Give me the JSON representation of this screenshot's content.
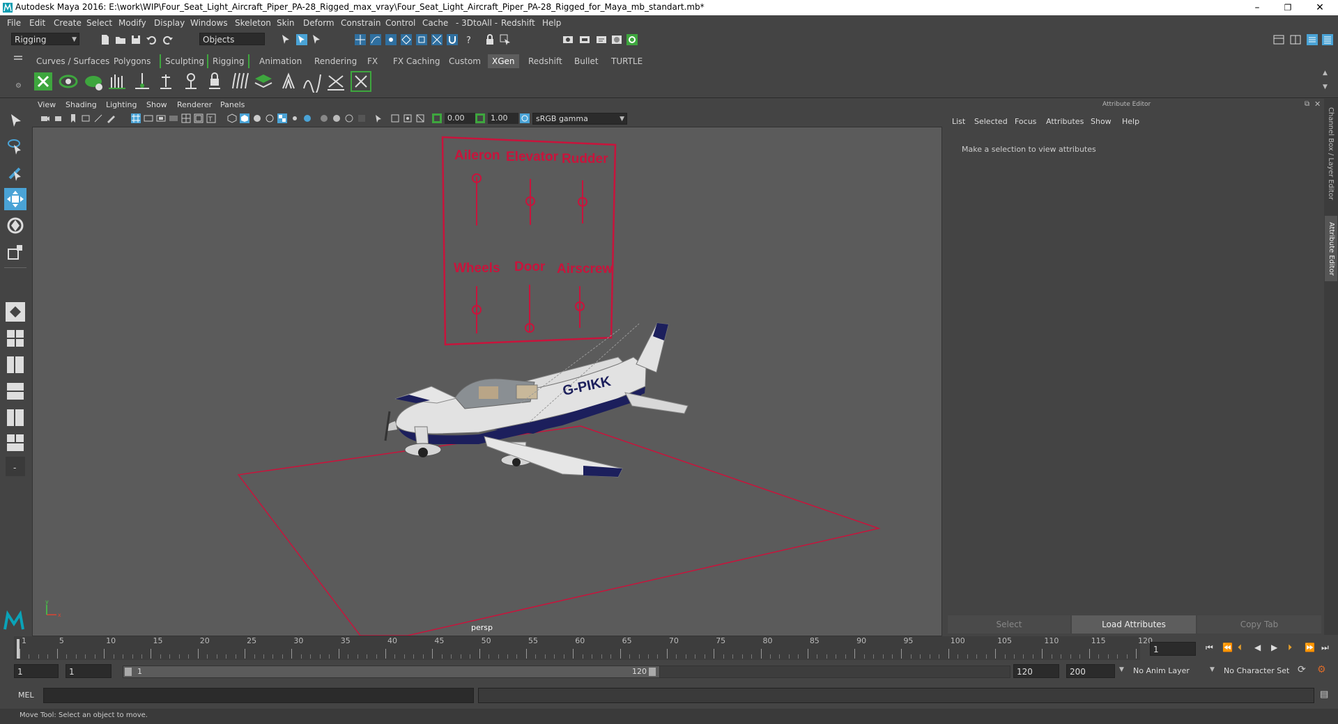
{
  "window": {
    "title": "Autodesk Maya 2016: E:\\work\\WIP\\Four_Seat_Light_Aircraft_Piper_PA-28_Rigged_max_vray\\Four_Seat_Light_Aircraft_Piper_PA-28_Rigged_for_Maya_mb_standart.mb*",
    "minimize": "–",
    "restore": "❐",
    "close": "✕"
  },
  "menubar": [
    "File",
    "Edit",
    "Create",
    "Select",
    "Modify",
    "Display",
    "Windows",
    "Skeleton",
    "Skin",
    "Deform",
    "Constrain",
    "Control",
    "Cache",
    "- 3DtoAll -",
    "Redshift",
    "Help"
  ],
  "toolbar": {
    "mode": "Rigging",
    "selection_mask": "Objects"
  },
  "shelf_tabs": {
    "items": [
      "Curves / Surfaces",
      "Polygons",
      "Sculpting",
      "Rigging",
      "Animation",
      "Rendering",
      "FX",
      "FX Caching",
      "Custom",
      "XGen",
      "Redshift",
      "Bullet",
      "TURTLE"
    ],
    "active": "XGen"
  },
  "viewport": {
    "menu": [
      "View",
      "Shading",
      "Lighting",
      "Show",
      "Renderer",
      "Panels"
    ],
    "exposure": "0.00",
    "gamma": "1.00",
    "color_space": "sRGB gamma",
    "camera_label": "persp",
    "rig_labels": [
      "Aileron",
      "Elevator",
      "Rudder",
      "Wheels",
      "Door",
      "Airscrew"
    ],
    "rig_color": "#c8143c",
    "aircraft_registration": "G-PIKK",
    "aircraft_accent": "#1c1f5c"
  },
  "attribute_editor": {
    "header": "Attribute Editor",
    "menu": [
      "List",
      "Selected",
      "Focus",
      "Attributes",
      "Show",
      "Help"
    ],
    "message": "Make a selection to view attributes",
    "buttons": {
      "select": "Select",
      "load": "Load Attributes",
      "copy_tab": "Copy Tab"
    },
    "side_tabs": {
      "channel_box": "Channel Box / Layer Editor",
      "attribute_editor": "Attribute Editor"
    }
  },
  "timeline": {
    "ticks": [
      "1",
      "5",
      "10",
      "15",
      "20",
      "25",
      "30",
      "35",
      "40",
      "45",
      "50",
      "55",
      "60",
      "65",
      "70",
      "75",
      "80",
      "85",
      "90",
      "95",
      "100",
      "105",
      "110",
      "115",
      "120"
    ],
    "current_frame": "1"
  },
  "range": {
    "start": "1",
    "start_inner": "1",
    "slider_start": "1",
    "slider_end": "120",
    "end_inner": "120",
    "end": "200",
    "anim_layer": "No Anim Layer",
    "character_set": "No Character Set"
  },
  "command_line": {
    "label": "MEL"
  },
  "help_line": {
    "text": "Move Tool: Select an object to move."
  },
  "colors": {
    "accent_green": "#3ea63e",
    "accent_blue": "#4aa3d6",
    "panel": "#444444",
    "viewport": "#5b5b5b"
  }
}
